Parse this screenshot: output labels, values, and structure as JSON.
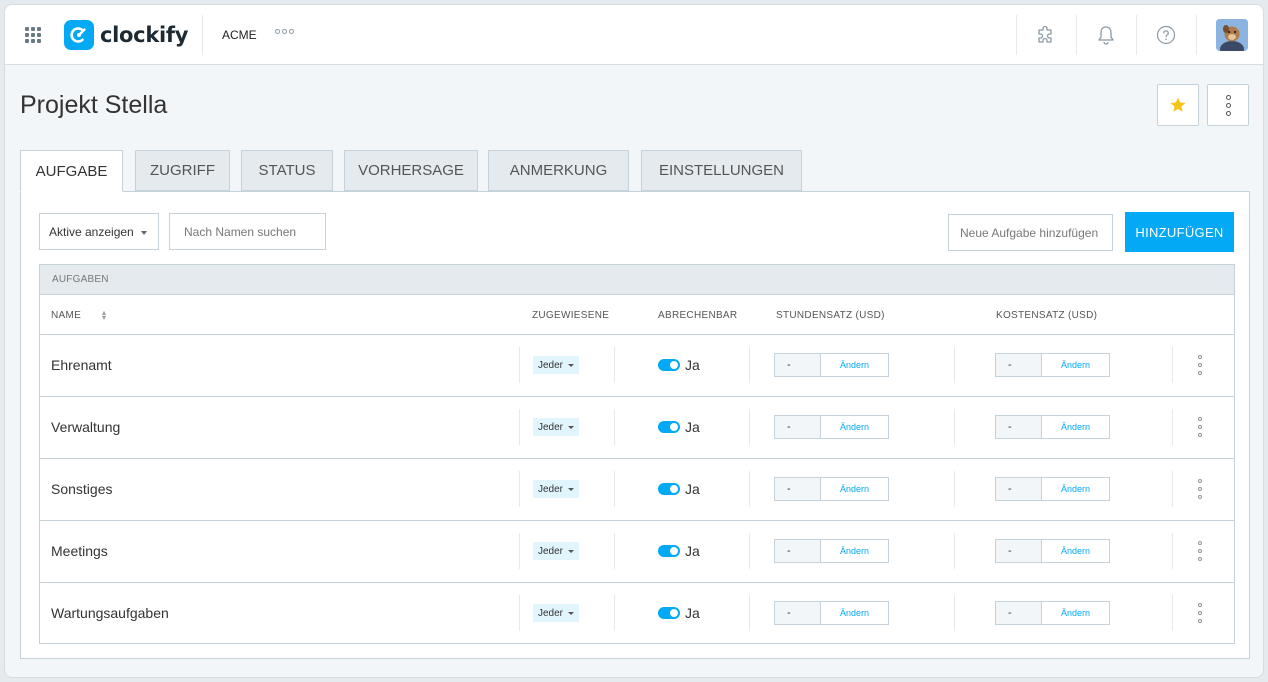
{
  "app": {
    "name": "clockify",
    "workspace": "ACME"
  },
  "topbar": {
    "icons": [
      "apps-grid-icon",
      "puzzle-icon",
      "bell-icon",
      "help-icon"
    ]
  },
  "page": {
    "title": "Projekt Stella"
  },
  "tabs": [
    {
      "label": "AUFGABE",
      "active": true
    },
    {
      "label": "ZUGRIFF",
      "active": false
    },
    {
      "label": "STATUS",
      "active": false
    },
    {
      "label": "VORHERSAGE",
      "active": false
    },
    {
      "label": "ANMERKUNG",
      "active": false
    },
    {
      "label": "EINSTELLUNGEN",
      "active": false
    }
  ],
  "filters": {
    "status_select": "Aktive anzeigen",
    "search_placeholder": "Nach Namen suchen",
    "new_task_placeholder": "Neue Aufgabe hinzufügen",
    "add_button": "HINZUFÜGEN"
  },
  "table": {
    "caption": "AUFGABEN",
    "columns": {
      "name": "NAME",
      "assigned": "ZUGEWIESENE",
      "billable": "ABRECHENBAR",
      "hourly_rate": "STUNDENSATZ (USD)",
      "cost_rate": "KOSTENSATZ (USD)"
    },
    "rows": [
      {
        "name": "Ehrenamt",
        "assigned": "Jeder",
        "billable": "Ja",
        "hourly_rate": "-",
        "cost_rate": "-",
        "change": "Ändern"
      },
      {
        "name": "Verwaltung",
        "assigned": "Jeder",
        "billable": "Ja",
        "hourly_rate": "-",
        "cost_rate": "-",
        "change": "Ändern"
      },
      {
        "name": "Sonstiges",
        "assigned": "Jeder",
        "billable": "Ja",
        "hourly_rate": "-",
        "cost_rate": "-",
        "change": "Ändern"
      },
      {
        "name": "Meetings",
        "assigned": "Jeder",
        "billable": "Ja",
        "hourly_rate": "-",
        "cost_rate": "-",
        "change": "Ändern"
      },
      {
        "name": "Wartungsaufgaben",
        "assigned": "Jeder",
        "billable": "Ja",
        "hourly_rate": "-",
        "cost_rate": "-",
        "change": "Ändern"
      }
    ]
  },
  "colors": {
    "accent": "#03a9f4",
    "star": "#f5c518",
    "tab_inactive": "#e4eaee",
    "badge_bg": "#e1f5fe"
  }
}
